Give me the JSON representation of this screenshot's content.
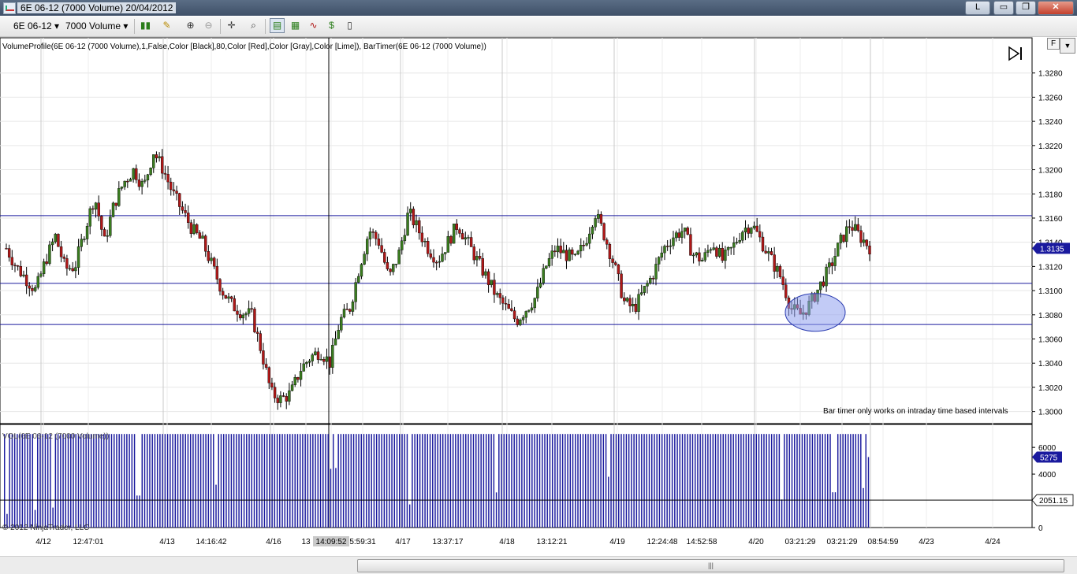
{
  "window": {
    "title": "6E 06-12 (7000 Volume)  20/04/2012",
    "buttons": [
      "L",
      "▭",
      "❐",
      "✕"
    ]
  },
  "toolbar": {
    "instrument": "6E 06-12",
    "interval": "7000 Volume",
    "icons": [
      "candlestick-style-icon",
      "pencil-draw-icon",
      "zoom-in-icon",
      "zoom-out-icon",
      "crosshair-icon",
      "magnify-icon",
      "bar-chart-icon",
      "strategy-icon",
      "indicator-icon",
      "dollar-icon",
      "properties-icon"
    ]
  },
  "indicators_label": "VolumeProfile(6E 06-12 (7000 Volume),1,False,Color [Black],80,Color [Red],Color [Gray],Color [Lime]), BarTimer(6E 06-12 (7000 Volume))",
  "bar_timer_note": "Bar timer only works on intraday time based intervals",
  "volume_panel_label": "VOL(6E 06-12 (7000 Volume))",
  "copyright": "© 2012 NinjaTrader, LLC",
  "f_button": "F",
  "colors": {
    "up_candle": "#3a7d1f",
    "down_candle": "#b01818",
    "hline": "#1a1a9e",
    "volume_bar": "#1a1a9e",
    "last_price_bg": "#1a1a9e",
    "highlight_ellipse": "#8fa0ee"
  },
  "chart_data": {
    "type": "candlestick",
    "instrument": "6E 06-12",
    "price_axis_ticks": [
      "1.3280",
      "1.3260",
      "1.3240",
      "1.3220",
      "1.3200",
      "1.3180",
      "1.3160",
      "1.3140",
      "1.3120",
      "1.3100",
      "1.3080",
      "1.3060",
      "1.3040",
      "1.3020",
      "1.3000"
    ],
    "price_range": [
      1.299,
      1.33
    ],
    "last_price": "1.3135",
    "horizontal_lines": [
      1.3162,
      1.3106,
      1.3072
    ],
    "price_path": [
      1.3135,
      1.312,
      1.311,
      1.31,
      1.3125,
      1.3145,
      1.3118,
      1.312,
      1.315,
      1.3178,
      1.314,
      1.3172,
      1.319,
      1.32,
      1.3185,
      1.3215,
      1.32,
      1.318,
      1.3165,
      1.315,
      1.314,
      1.312,
      1.31,
      1.3088,
      1.3082,
      1.308,
      1.305,
      1.3015,
      1.301,
      1.3015,
      1.3035,
      1.3045,
      1.305,
      1.304,
      1.3075,
      1.3085,
      1.312,
      1.315,
      1.314,
      1.311,
      1.313,
      1.3165,
      1.315,
      1.3135,
      1.3125,
      1.314,
      1.3155,
      1.314,
      1.3125,
      1.311,
      1.3095,
      1.3085,
      1.3075,
      1.3085,
      1.3095,
      1.312,
      1.3135,
      1.313,
      1.3125,
      1.314,
      1.3165,
      1.3145,
      1.312,
      1.309,
      1.3085,
      1.31,
      1.3115,
      1.3135,
      1.3145,
      1.315,
      1.313,
      1.3125,
      1.314,
      1.3125,
      1.3135,
      1.315,
      1.3155,
      1.314,
      1.3125,
      1.311,
      1.3085,
      1.308,
      1.309,
      1.3105,
      1.312,
      1.314,
      1.3155,
      1.3145,
      1.3136
    ],
    "volume_axis_ticks": [
      "6000",
      "4000",
      "2000",
      "0"
    ],
    "volume_range": [
      0,
      7600
    ],
    "volume_max": 7000,
    "volume_last": "5275",
    "volume_line_value": "2051.15",
    "volume_line": 2051.15,
    "volume_dips": [
      0.002,
      0.035,
      0.055,
      0.155,
      0.245,
      0.377,
      0.384,
      0.47,
      0.57,
      0.7,
      0.9,
      0.96,
      0.995
    ],
    "time_labels": [
      "4/12",
      "12:47:01",
      "4/13",
      "14:16:42",
      "4/16",
      "13",
      "14:09:52",
      "5:59:31",
      "4/17",
      "13:37:17",
      "4/18",
      "13:12:21",
      "4/19",
      "12:24:48",
      "14:52:58",
      "4/20",
      "03:21:29",
      "03:21:29",
      "08:54:59",
      "4/23",
      "4/24"
    ],
    "crosshair_time": "14:09:52"
  }
}
